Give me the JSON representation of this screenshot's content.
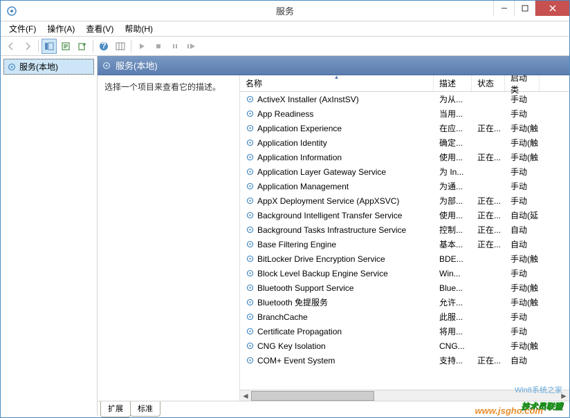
{
  "window": {
    "title": "服务"
  },
  "menu": {
    "file": "文件(F)",
    "action": "操作(A)",
    "view": "查看(V)",
    "help": "帮助(H)"
  },
  "tree": {
    "root": "服务(本地)"
  },
  "panel": {
    "header": "服务(本地)",
    "description": "选择一个项目来查看它的描述。"
  },
  "columns": {
    "name": "名称",
    "desc": "描述",
    "status": "状态",
    "startup": "启动类"
  },
  "tabs": {
    "extended": "扩展",
    "standard": "标准"
  },
  "services": [
    {
      "name": "ActiveX Installer (AxInstSV)",
      "desc": "为从...",
      "status": "",
      "startup": "手动"
    },
    {
      "name": "App Readiness",
      "desc": "当用...",
      "status": "",
      "startup": "手动"
    },
    {
      "name": "Application Experience",
      "desc": "在应...",
      "status": "正在...",
      "startup": "手动(触"
    },
    {
      "name": "Application Identity",
      "desc": "确定...",
      "status": "",
      "startup": "手动(触"
    },
    {
      "name": "Application Information",
      "desc": "使用...",
      "status": "正在...",
      "startup": "手动(触"
    },
    {
      "name": "Application Layer Gateway Service",
      "desc": "为 In...",
      "status": "",
      "startup": "手动"
    },
    {
      "name": "Application Management",
      "desc": "为通...",
      "status": "",
      "startup": "手动"
    },
    {
      "name": "AppX Deployment Service (AppXSVC)",
      "desc": "为部...",
      "status": "正在...",
      "startup": "手动"
    },
    {
      "name": "Background Intelligent Transfer Service",
      "desc": "使用...",
      "status": "正在...",
      "startup": "自动(延"
    },
    {
      "name": "Background Tasks Infrastructure Service",
      "desc": "控制...",
      "status": "正在...",
      "startup": "自动"
    },
    {
      "name": "Base Filtering Engine",
      "desc": "基本...",
      "status": "正在...",
      "startup": "自动"
    },
    {
      "name": "BitLocker Drive Encryption Service",
      "desc": "BDE...",
      "status": "",
      "startup": "手动(触"
    },
    {
      "name": "Block Level Backup Engine Service",
      "desc": "Win...",
      "status": "",
      "startup": "手动"
    },
    {
      "name": "Bluetooth Support Service",
      "desc": "Blue...",
      "status": "",
      "startup": "手动(触"
    },
    {
      "name": "Bluetooth 免提服务",
      "desc": "允许...",
      "status": "",
      "startup": "手动(触"
    },
    {
      "name": "BranchCache",
      "desc": "此服...",
      "status": "",
      "startup": "手动"
    },
    {
      "name": "Certificate Propagation",
      "desc": "将用...",
      "status": "",
      "startup": "手动"
    },
    {
      "name": "CNG Key Isolation",
      "desc": "CNG...",
      "status": "",
      "startup": "手动(触"
    },
    {
      "name": "COM+ Event System",
      "desc": "支持...",
      "status": "正在...",
      "startup": "自动"
    }
  ],
  "watermark": {
    "text1": "技术员联盟",
    "sub": "Win8系统之家",
    "url": "www.jsgho.com"
  }
}
